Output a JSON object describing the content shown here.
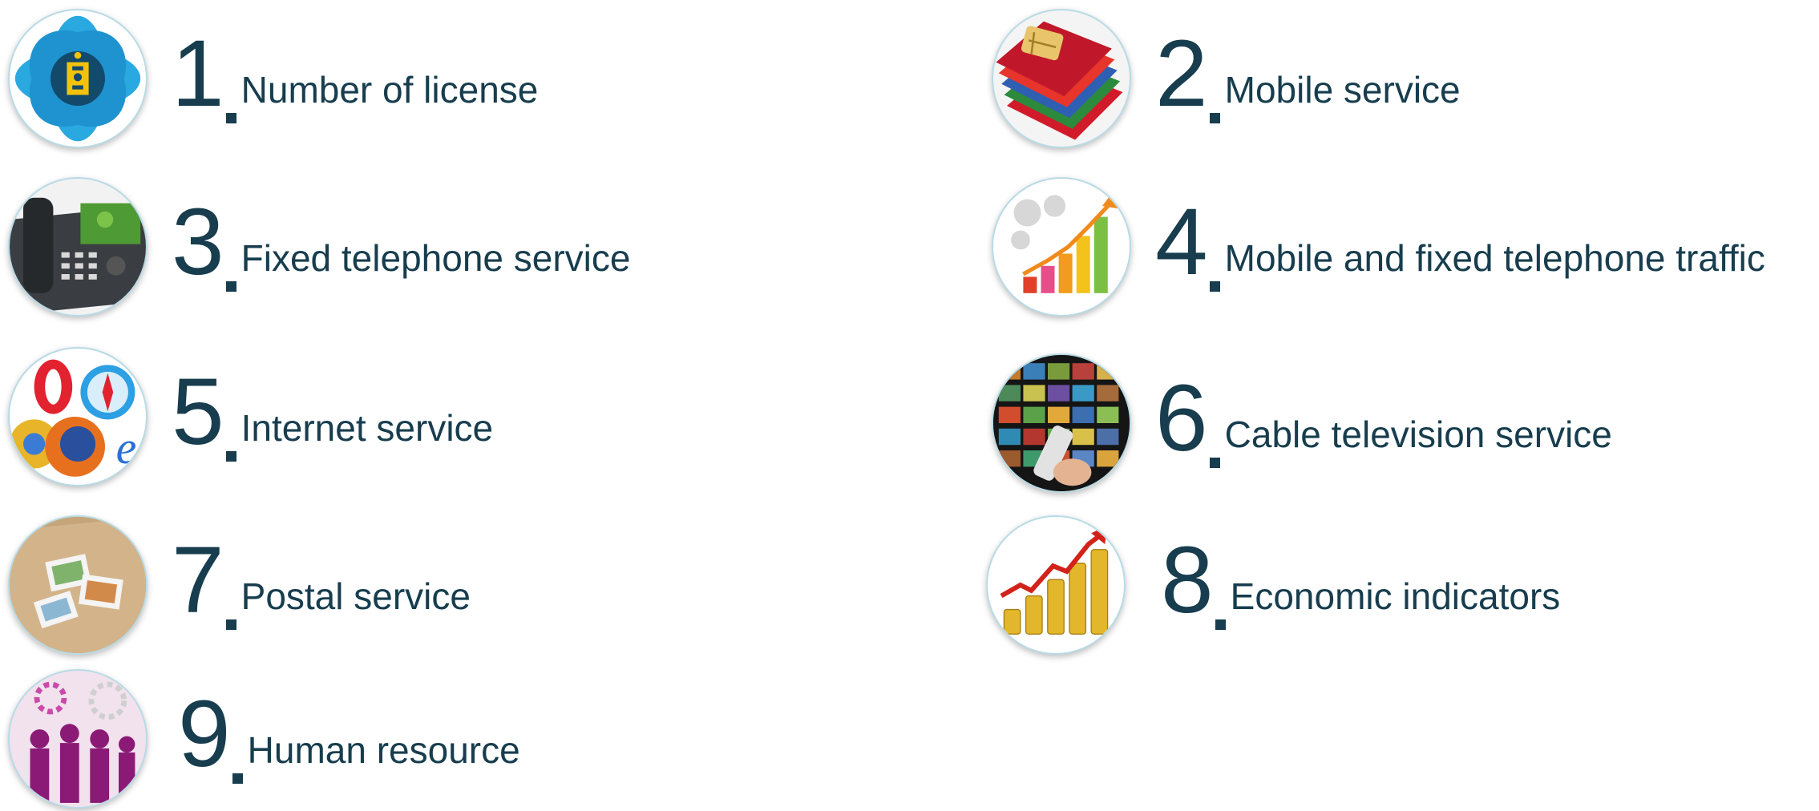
{
  "items": [
    {
      "number": "1",
      "label": "Number of license",
      "icon": "soyombo-emblem-icon"
    },
    {
      "number": "2",
      "label": "Mobile service",
      "icon": "sim-card-icon"
    },
    {
      "number": "3",
      "label": "Fixed telephone service",
      "icon": "desk-phone-icon"
    },
    {
      "number": "4",
      "label": "Mobile and fixed telephone traffic",
      "icon": "growth-chart-icon"
    },
    {
      "number": "5",
      "label": "Internet service",
      "icon": "browser-logos-icon"
    },
    {
      "number": "6",
      "label": "Cable television service",
      "icon": "tv-remote-icon"
    },
    {
      "number": "7",
      "label": "Postal service",
      "icon": "stamps-envelope-icon"
    },
    {
      "number": "8",
      "label": "Economic indicators",
      "icon": "coins-chart-icon"
    },
    {
      "number": "9",
      "label": "Human resource",
      "icon": "people-gears-icon"
    }
  ],
  "colors": {
    "text": "#173d4e",
    "ring": "#b9dbe6",
    "emblem_blue": "#2aa8e0"
  }
}
